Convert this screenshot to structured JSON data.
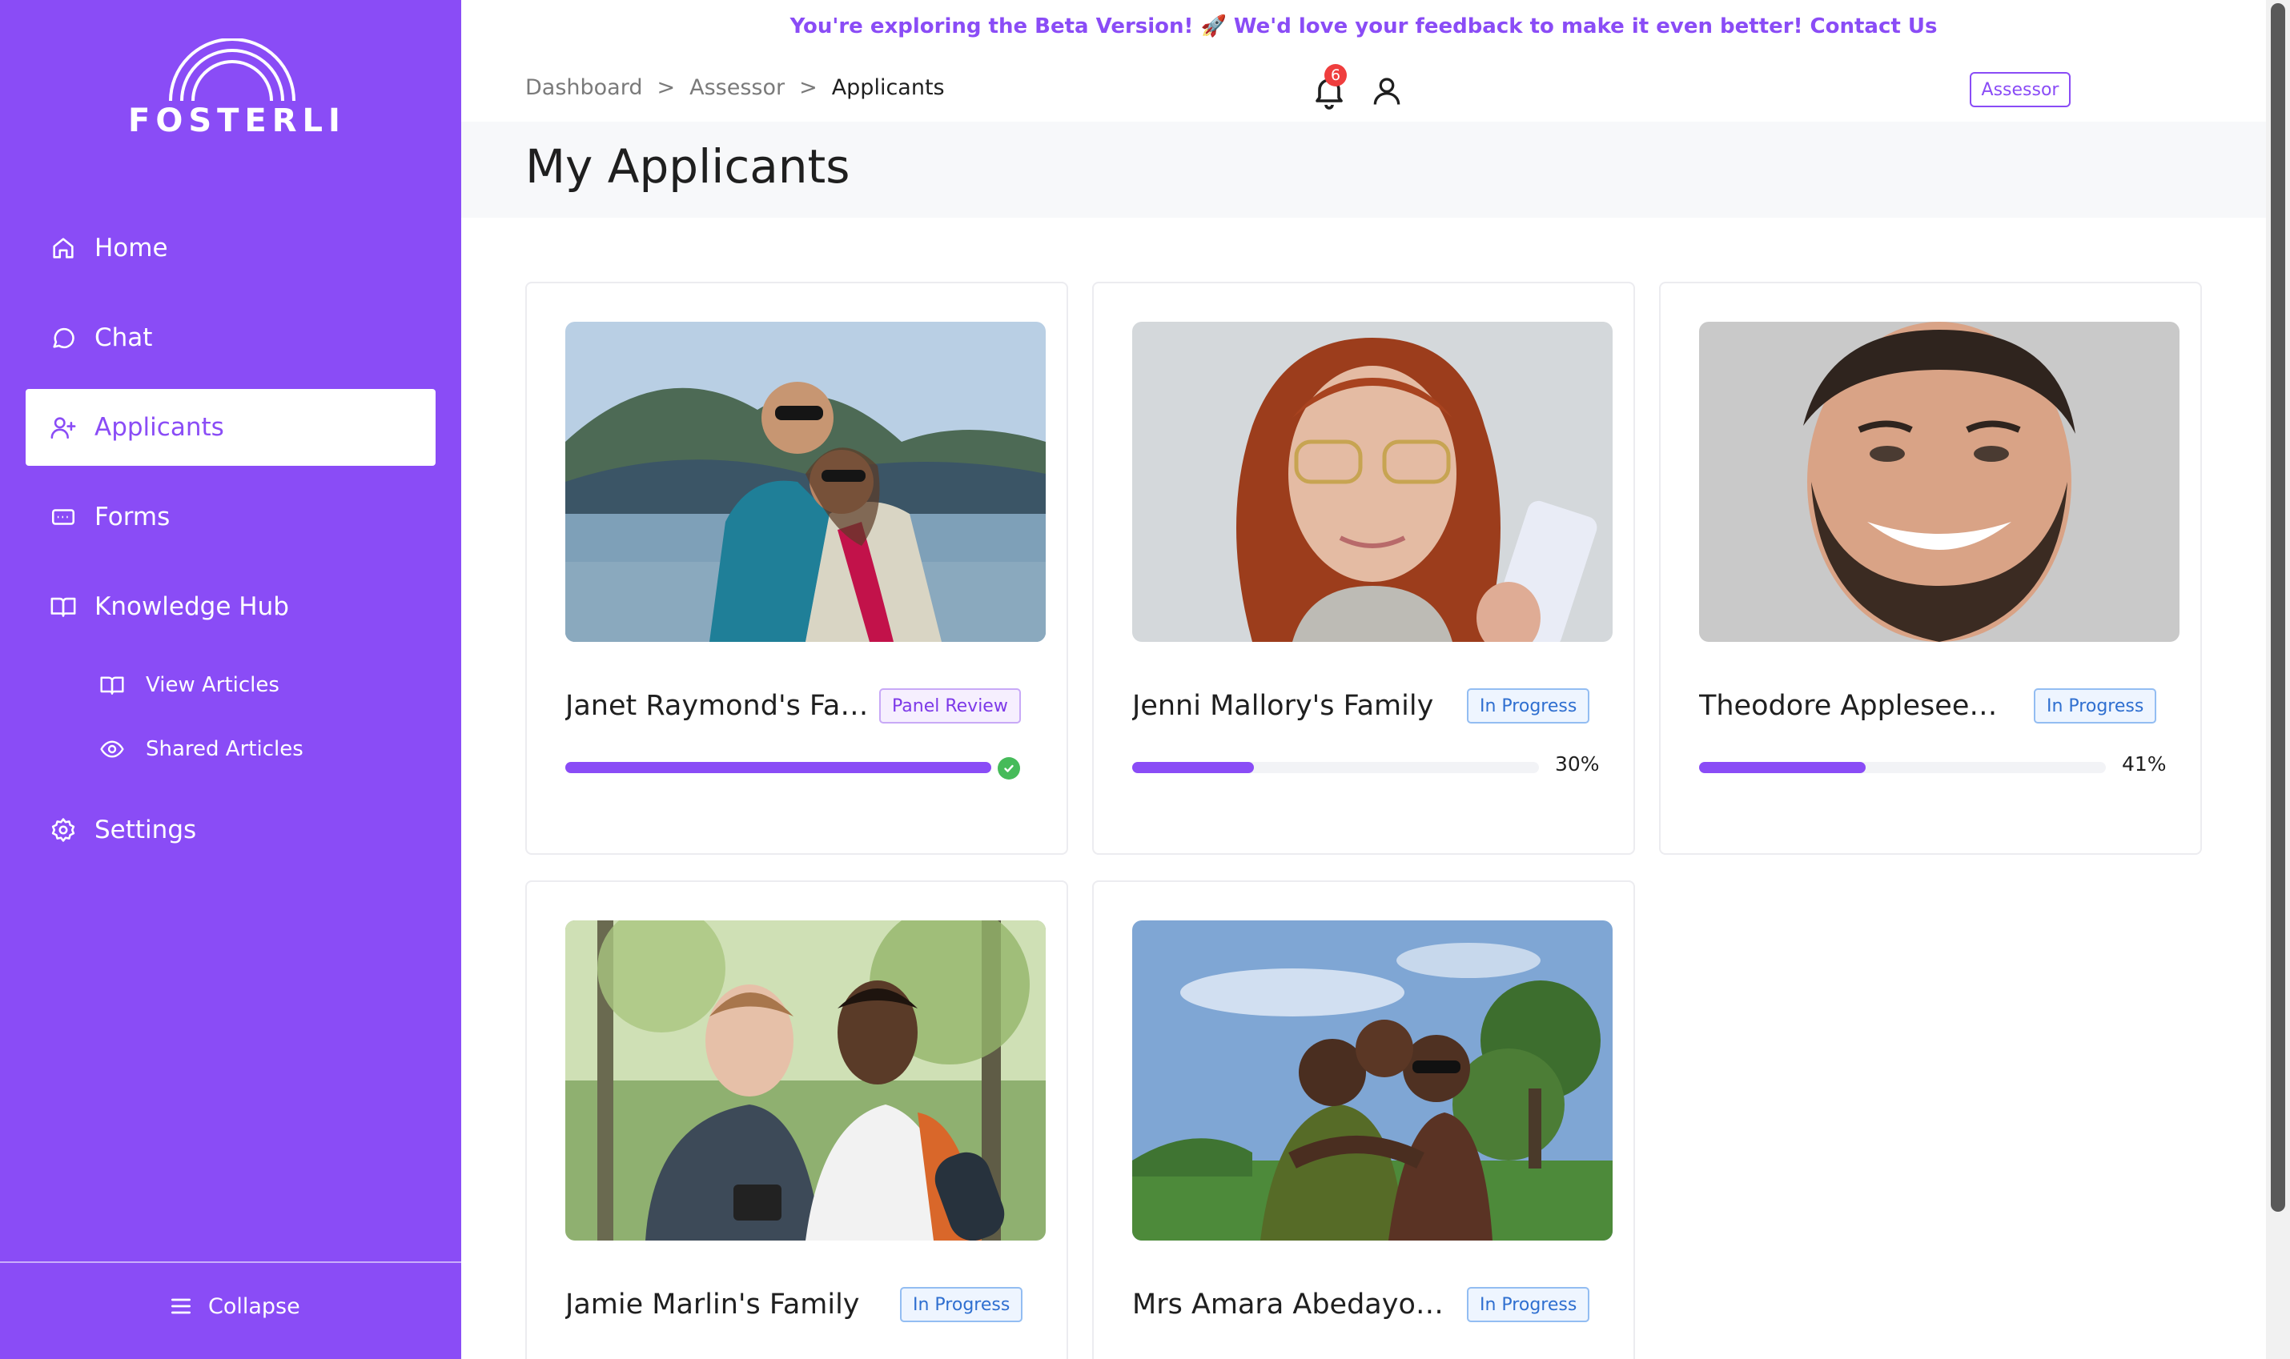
{
  "brand": {
    "name": "FOSTERLI"
  },
  "sidebar": {
    "items": [
      {
        "label": "Home"
      },
      {
        "label": "Chat"
      },
      {
        "label": "Applicants"
      },
      {
        "label": "Forms"
      },
      {
        "label": "Knowledge Hub"
      },
      {
        "label": "View Articles"
      },
      {
        "label": "Shared Articles"
      },
      {
        "label": "Settings"
      }
    ],
    "collapse_label": "Collapse",
    "active": "Applicants"
  },
  "banner": {
    "text": "You're exploring the Beta Version! 🚀 We'd love your feedback to make it even better!",
    "link": "Contact Us"
  },
  "breadcrumb": [
    "Dashboard",
    "Assessor",
    "Applicants"
  ],
  "breadcrumb_separator": ">",
  "header": {
    "role": "Assessor",
    "notification_count": "6"
  },
  "page": {
    "title": "My Applicants"
  },
  "applicants": [
    {
      "name": "Janet Raymond's Family",
      "status": "Panel Review",
      "progress": 1.0,
      "progress_label": "",
      "complete": true
    },
    {
      "name": "Jenni Mallory's Family",
      "status": "In Progress",
      "progress": 0.3,
      "progress_label": "30%",
      "complete": false
    },
    {
      "name": "Theodore Appleseed's F...",
      "status": "In Progress",
      "progress": 0.41,
      "progress_label": "41%",
      "complete": false
    },
    {
      "name": "Jamie Marlin's Family",
      "status": "In Progress",
      "progress": null,
      "progress_label": "",
      "complete": false
    },
    {
      "name": "Mrs Amara Abedayo 's ...",
      "status": "In Progress",
      "progress": null,
      "progress_label": "",
      "complete": false
    }
  ],
  "colors": {
    "brand": "#8a4cf6",
    "panel_review": "#7d39e8",
    "in_progress": "#2f6fd0",
    "success": "#46bb5a",
    "notification": "#ef3e3e"
  }
}
